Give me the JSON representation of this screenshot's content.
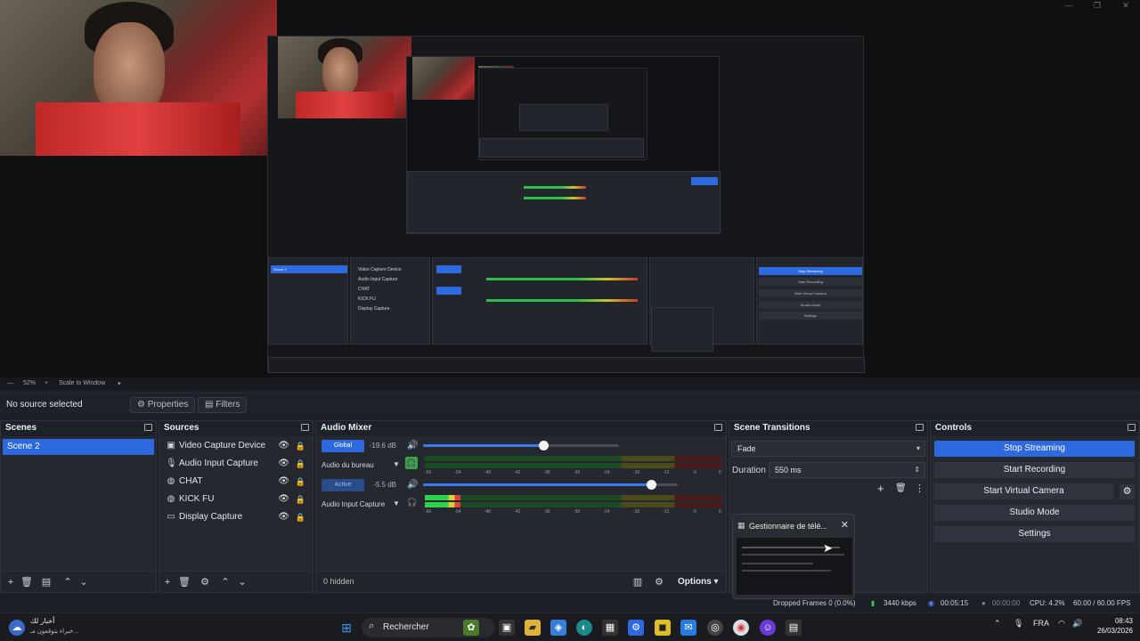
{
  "window_controls": [
    "—",
    "❐",
    "✕"
  ],
  "preview": {
    "zoom_label": "52%",
    "scale_label": "Scale to Window"
  },
  "context_bar": {
    "no_source": "No source selected",
    "properties": "Properties",
    "filters": "Filters"
  },
  "scenes": {
    "title": "Scenes",
    "items": [
      "Scene 2"
    ]
  },
  "sources": {
    "title": "Sources",
    "items": [
      {
        "name": "Video Capture Device",
        "icon": "camera-icon"
      },
      {
        "name": "Audio Input Capture",
        "icon": "microphone-icon"
      },
      {
        "name": "CHAT",
        "icon": "globe-icon"
      },
      {
        "name": "KICK FU",
        "icon": "globe-icon"
      },
      {
        "name": "Display Capture",
        "icon": "monitor-icon"
      }
    ]
  },
  "mixer": {
    "title": "Audio Mixer",
    "channels": [
      {
        "badge": "Global",
        "db": "-19.6 dB",
        "name": "Audio du bureau",
        "fader": 0.62,
        "level": 0.0
      },
      {
        "badge": "Active",
        "db": "-5.5 dB",
        "name": "Audio Input Capture",
        "fader": 0.9,
        "level": 0.12
      }
    ],
    "ticks": [
      "-60",
      "-54",
      "-48",
      "-42",
      "-36",
      "-30",
      "-24",
      "-18",
      "-12",
      "-6",
      "0"
    ],
    "hidden": "0 hidden",
    "options": "Options"
  },
  "transitions": {
    "title": "Scene Transitions",
    "selected": "Fade",
    "duration_label": "Duration",
    "duration_value": "550 ms"
  },
  "controls": {
    "title": "Controls",
    "stop_streaming": "Stop Streaming",
    "start_recording": "Start Recording",
    "start_virtual_camera": "Start Virtual Camera",
    "studio_mode": "Studio Mode",
    "settings": "Settings"
  },
  "popup": {
    "title": "Gestionnaire de télé..."
  },
  "status": {
    "dropped": "Dropped Frames 0 (0.0%)",
    "bitrate": "3440 kbps",
    "stream_time": "00:05:15",
    "rec_time": "00:00:00",
    "cpu": "CPU: 4.2%",
    "fps": "60.00 / 60.00 FPS"
  },
  "taskbar": {
    "news_line1": "أخبار لك",
    "news_line2": "خبراء يتوقعون مـ...",
    "search": "Rechercher",
    "lang": "FRA",
    "time": "08:43",
    "date": "26/03/2026"
  },
  "colors": {
    "accent": "#2d6ae0",
    "meter_green": "#2fd44e",
    "meter_yellow": "#d8d03a",
    "meter_red": "#e0403a"
  }
}
